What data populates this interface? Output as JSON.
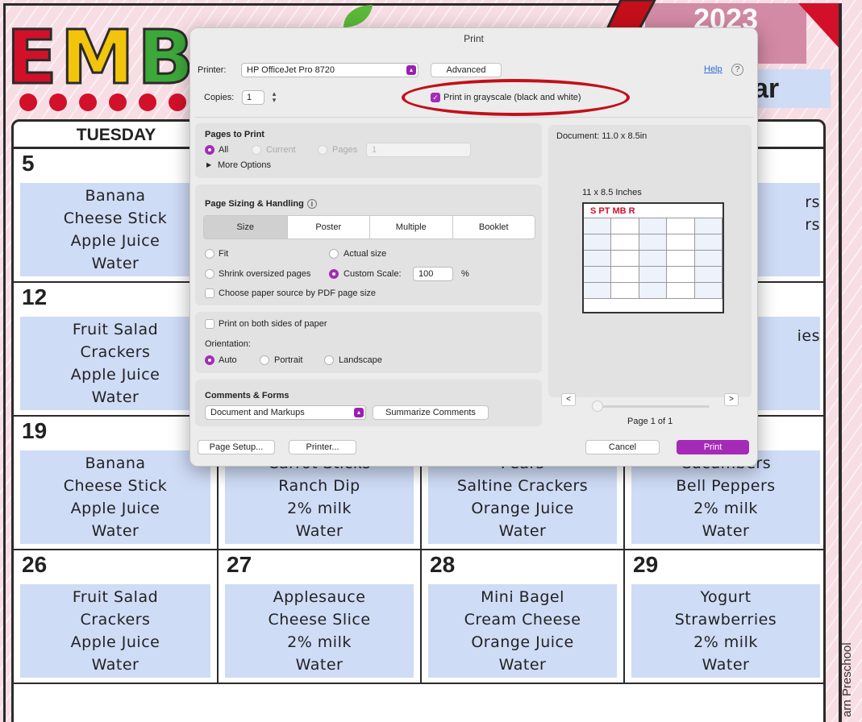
{
  "calendar": {
    "month_letters": [
      "E",
      "M",
      "B"
    ],
    "year": "2023",
    "subtitle_fragment": "ar",
    "day_header": "TUESDAY",
    "side_credit": "arn Preschool",
    "rows": [
      {
        "cols": [
          {
            "num": "5",
            "items": [
              "Banana",
              "Cheese Stick",
              "Apple Juice",
              "Water"
            ]
          },
          {
            "num": "",
            "items": []
          },
          {
            "num": "",
            "items": []
          },
          {
            "num": "",
            "items": [
              "rs",
              "rs"
            ]
          }
        ]
      },
      {
        "cols": [
          {
            "num": "12",
            "items": [
              "Fruit Salad",
              "Crackers",
              "Apple Juice",
              "Water"
            ]
          },
          {
            "num": "",
            "items": []
          },
          {
            "num": "",
            "items": []
          },
          {
            "num": "",
            "items": [
              "ies"
            ]
          }
        ]
      },
      {
        "cols": [
          {
            "num": "19",
            "items": [
              "Banana",
              "Cheese Stick",
              "Apple Juice",
              "Water"
            ]
          },
          {
            "num": "",
            "items": [
              "Carrot Sticks",
              "Ranch Dip",
              "2% milk",
              "Water"
            ]
          },
          {
            "num": "",
            "items": [
              "Pears",
              "Saltine Crackers",
              "Orange Juice",
              "Water"
            ]
          },
          {
            "num": "",
            "items": [
              "Cucumbers",
              "Bell Peppers",
              "2% milk",
              "Water"
            ]
          }
        ]
      },
      {
        "cols": [
          {
            "num": "26",
            "items": [
              "Fruit Salad",
              "Crackers",
              "Apple Juice",
              "Water"
            ]
          },
          {
            "num": "27",
            "items": [
              "Applesauce",
              "Cheese Slice",
              "2% milk",
              "Water"
            ]
          },
          {
            "num": "28",
            "items": [
              "Mini Bagel",
              "Cream Cheese",
              "Orange Juice",
              "Water"
            ]
          },
          {
            "num": "29",
            "items": [
              "Yogurt",
              "Strawberries",
              "2% milk",
              "Water"
            ]
          }
        ]
      }
    ]
  },
  "dialog": {
    "title": "Print",
    "printer_label": "Printer:",
    "printer_value": "HP OfficeJet Pro 8720",
    "advanced_button": "Advanced",
    "help_link": "Help",
    "help_q": "?",
    "copies_label": "Copies:",
    "copies_value": "1",
    "grayscale_label": "Print in grayscale (black and white)",
    "grayscale_checked": true,
    "pages_to_print": {
      "heading": "Pages to Print",
      "all": "All",
      "current": "Current",
      "pages": "Pages",
      "pages_value": "1",
      "more_options": "More Options"
    },
    "page_sizing": {
      "heading": "Page Sizing & Handling",
      "tabs": [
        "Size",
        "Poster",
        "Multiple",
        "Booklet"
      ],
      "selected_tab": "Size",
      "fit": "Fit",
      "actual_size": "Actual size",
      "shrink": "Shrink oversized pages",
      "custom_scale": "Custom Scale:",
      "scale_value": "100",
      "scale_unit": "%",
      "paper_source": "Choose paper source by PDF page size"
    },
    "layout": {
      "both_sides": "Print on both sides of paper",
      "orientation_label": "Orientation:",
      "auto": "Auto",
      "portrait": "Portrait",
      "landscape": "Landscape"
    },
    "comments": {
      "heading": "Comments & Forms",
      "select_value": "Document and Markups",
      "summarize_button": "Summarize Comments"
    },
    "preview": {
      "document_size": "Document: 11.0 x 8.5in",
      "paper_label": "11 x 8.5 Inches",
      "thumb_title": "S PT MB R",
      "prev": "<",
      "next": ">",
      "page_indicator": "Page 1 of 1"
    },
    "footer": {
      "page_setup": "Page Setup...",
      "printer": "Printer...",
      "cancel": "Cancel",
      "print": "Print"
    }
  },
  "colors": {
    "accent": "#a52ab8",
    "annotation": "#c40f1a",
    "cell_fill": "#cfdcf6",
    "background": "#f7dde4"
  }
}
